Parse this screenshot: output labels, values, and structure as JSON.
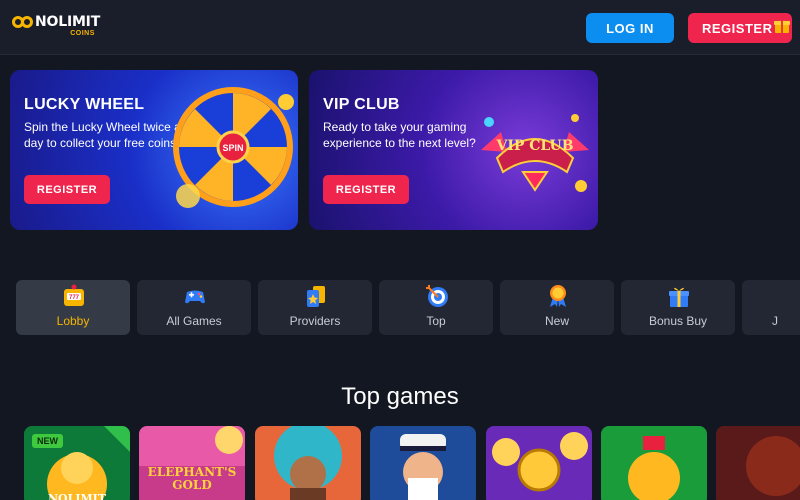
{
  "header": {
    "logo_main": "NOLIMIT",
    "logo_sub": "COINS",
    "login_label": "LOG IN",
    "register_label": "REGISTER"
  },
  "banners": [
    {
      "title": "LUCKY WHEEL",
      "text": "Spin the Lucky Wheel twice a day to collect your free coins",
      "button": "REGISTER",
      "wheel_center": "SPIN"
    },
    {
      "title": "VIP CLUB",
      "text": "Ready to take your gaming experience to the next level?",
      "button": "REGISTER",
      "badge_text": "VIP CLUB"
    }
  ],
  "categories": [
    {
      "label": "Lobby",
      "icon": "slot-machine-icon",
      "active": true
    },
    {
      "label": "All Games",
      "icon": "gamepad-icon",
      "active": false
    },
    {
      "label": "Providers",
      "icon": "cards-icon",
      "active": false
    },
    {
      "label": "Top",
      "icon": "target-icon",
      "active": false
    },
    {
      "label": "New",
      "icon": "new-badge-icon",
      "active": false
    },
    {
      "label": "Bonus Buy",
      "icon": "gift-icon",
      "active": false
    },
    {
      "label": "J",
      "icon": "more-icon",
      "active": false
    }
  ],
  "section_title": "Top games",
  "games": [
    {
      "tag": "NEW",
      "word": "NOLIMIT"
    },
    {
      "tag": "",
      "word": "ELEPHANT'S GOLD"
    },
    {
      "tag": "",
      "word": ""
    },
    {
      "tag": "",
      "word": ""
    },
    {
      "tag": "",
      "word": ""
    },
    {
      "tag": "",
      "word": ""
    },
    {
      "tag": "",
      "word": ""
    }
  ],
  "colors": {
    "background": "#131722",
    "header": "#1a1e2a",
    "accent_gold": "#f7b500",
    "login_blue": "#0b8ef0",
    "register_red": "#f0254e",
    "category_bg": "#222733"
  }
}
